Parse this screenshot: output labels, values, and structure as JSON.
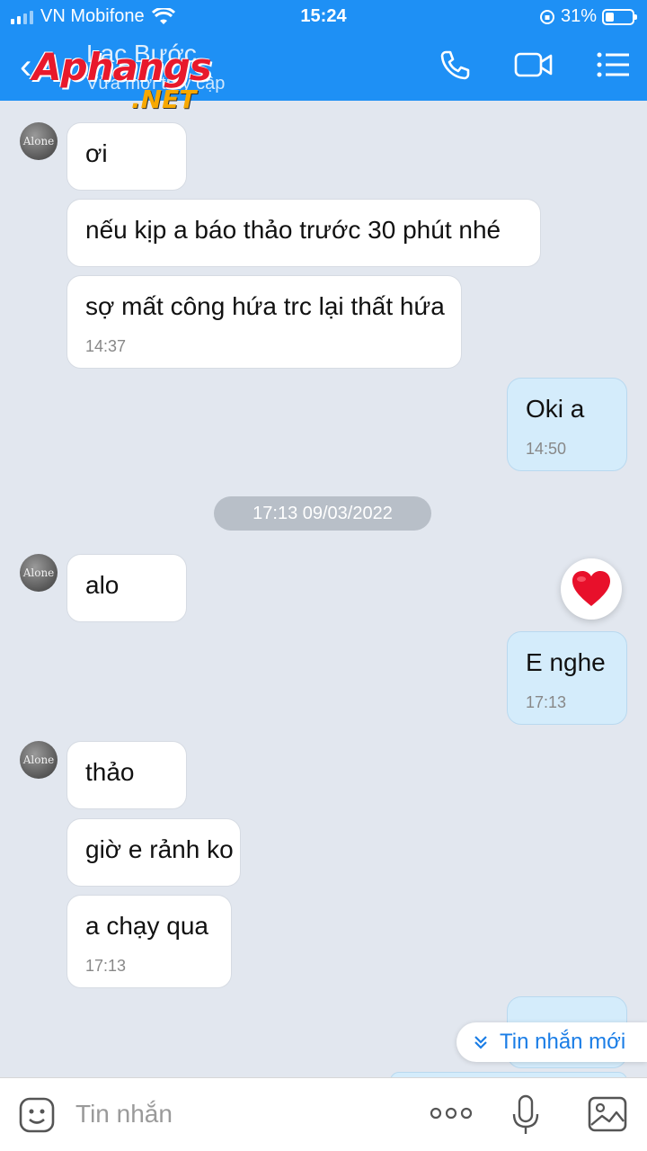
{
  "status_bar": {
    "carrier": "VN Mobifone",
    "time": "15:24",
    "battery": "31%",
    "battery_level": 0.31
  },
  "header": {
    "contact_name": "Lạc Bước",
    "contact_status": "Vừa mới truy cập",
    "watermark_main": "Aphangs",
    "watermark_net": ".NET"
  },
  "messages": {
    "m1": "ơi",
    "m2": "nếu kịp a báo thảo trước 30 phút nhé",
    "m3": "sợ mất công hứa trc lại thất hứa",
    "m3_time": "14:37",
    "m4": "Oki a",
    "m4_time": "14:50",
    "date_divider": "17:13 09/03/2022",
    "m5": "alo",
    "m6": "E nghe",
    "m6_time": "17:13",
    "m7": "thảo",
    "m8": "giờ e rảnh ko",
    "m9": "a chạy qua",
    "m9_time": "17:13",
    "avatar_text": "Alone"
  },
  "new_messages_label": "Tin nhắn mới",
  "composer": {
    "placeholder": "Tin nhắn"
  }
}
